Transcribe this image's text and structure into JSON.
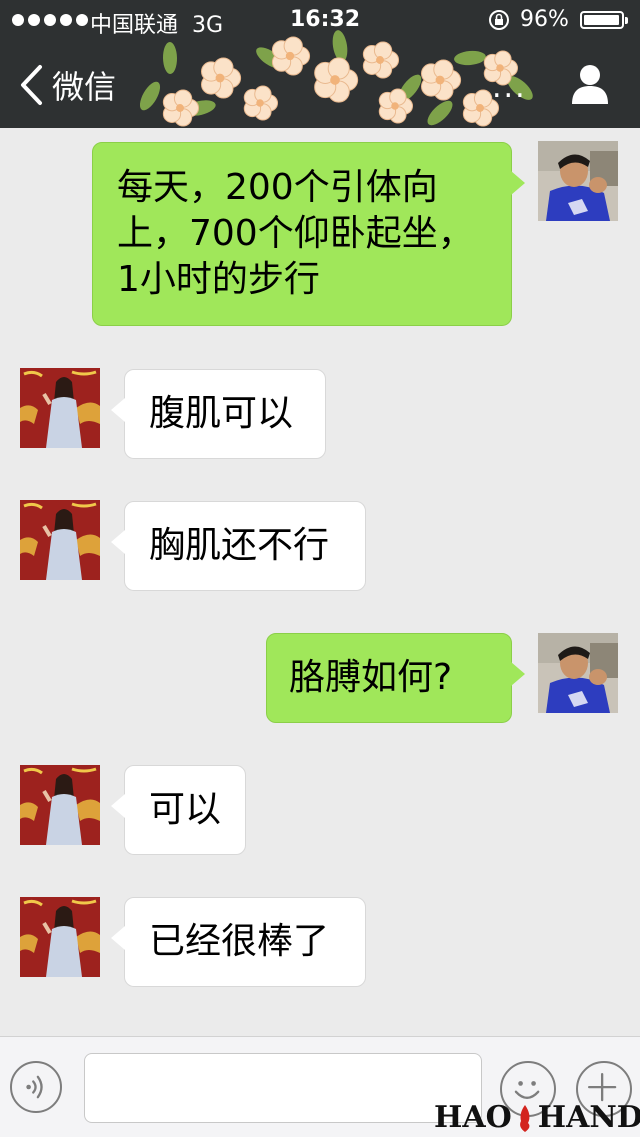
{
  "status_bar": {
    "carrier": "中国联通",
    "network": "3G",
    "time": "16:32",
    "battery_percent": "96%",
    "battery_level": 0.96
  },
  "nav": {
    "back_label": "微信",
    "title_ellipsis": "..."
  },
  "messages": [
    {
      "direction": "out",
      "text": "每天，200个引体向上，700个仰卧起坐，1小时的步行"
    },
    {
      "direction": "in",
      "text": "腹肌可以"
    },
    {
      "direction": "in",
      "text": "胸肌还不行"
    },
    {
      "direction": "out",
      "text": "胳膊如何?"
    },
    {
      "direction": "in",
      "text": "可以"
    },
    {
      "direction": "in",
      "text": "已经很棒了"
    }
  ],
  "input_bar": {
    "value": "",
    "icons": [
      "voice-icon",
      "emoji-icon",
      "plus-icon"
    ]
  },
  "watermark": {
    "left": "HAO",
    "right": "HAND"
  },
  "colors": {
    "nav_bg": "#2e3132",
    "chat_bg": "#ebebeb",
    "outgoing_bubble": "#a0e75a",
    "incoming_bubble": "#ffffff"
  }
}
